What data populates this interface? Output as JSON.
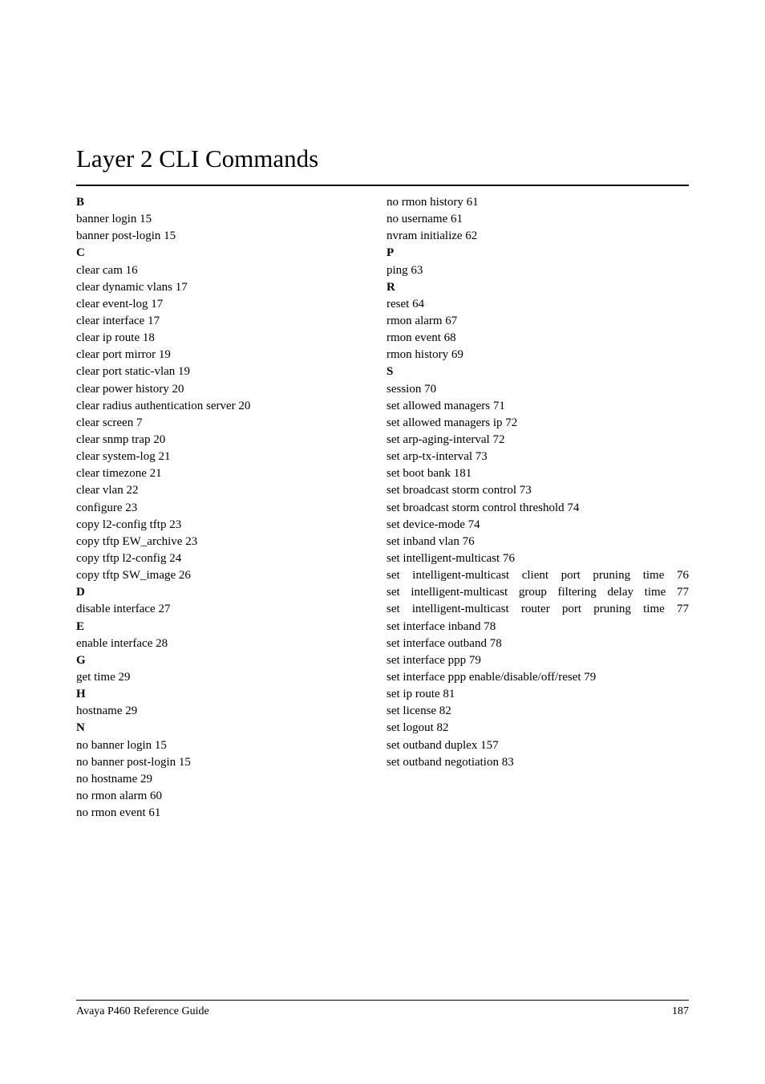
{
  "title": "Layer 2 CLI Commands",
  "left": [
    {
      "t": "letter",
      "v": "B"
    },
    {
      "t": "entry",
      "v": "banner login 15"
    },
    {
      "t": "entry",
      "v": "banner post-login 15"
    },
    {
      "t": "letter",
      "v": "C"
    },
    {
      "t": "entry",
      "v": "clear cam 16"
    },
    {
      "t": "entry",
      "v": "clear dynamic vlans 17"
    },
    {
      "t": "entry",
      "v": "clear event-log 17"
    },
    {
      "t": "entry",
      "v": "clear interface 17"
    },
    {
      "t": "entry",
      "v": "clear ip route 18"
    },
    {
      "t": "entry",
      "v": "clear port mirror 19"
    },
    {
      "t": "entry",
      "v": "clear port static-vlan 19"
    },
    {
      "t": "entry",
      "v": "clear power history 20"
    },
    {
      "t": "entry",
      "v": "clear radius authentication server 20"
    },
    {
      "t": "entry",
      "v": "clear screen 7"
    },
    {
      "t": "entry",
      "v": "clear snmp trap 20"
    },
    {
      "t": "entry",
      "v": "clear system-log 21"
    },
    {
      "t": "entry",
      "v": "clear timezone 21"
    },
    {
      "t": "entry",
      "v": "clear vlan 22"
    },
    {
      "t": "entry",
      "v": "configure 23"
    },
    {
      "t": "entry",
      "v": "copy l2-config tftp 23"
    },
    {
      "t": "entry",
      "v": "copy tftp EW_archive 23"
    },
    {
      "t": "entry",
      "v": "copy tftp l2-config 24"
    },
    {
      "t": "entry",
      "v": "copy tftp SW_image 26"
    },
    {
      "t": "letter",
      "v": "D"
    },
    {
      "t": "entry",
      "v": "disable interface 27"
    },
    {
      "t": "letter",
      "v": "E"
    },
    {
      "t": "entry",
      "v": "enable interface 28"
    },
    {
      "t": "letter",
      "v": "G"
    },
    {
      "t": "entry",
      "v": "get time 29"
    },
    {
      "t": "letter",
      "v": "H"
    },
    {
      "t": "entry",
      "v": "hostname 29"
    },
    {
      "t": "letter",
      "v": "N"
    },
    {
      "t": "entry",
      "v": "no banner login 15"
    },
    {
      "t": "entry",
      "v": "no banner post-login 15"
    },
    {
      "t": "entry",
      "v": "no hostname 29"
    },
    {
      "t": "entry",
      "v": "no rmon alarm 60"
    },
    {
      "t": "entry",
      "v": "no rmon event 61"
    }
  ],
  "right": [
    {
      "t": "entry",
      "v": "no rmon history 61"
    },
    {
      "t": "entry",
      "v": "no username 61"
    },
    {
      "t": "entry",
      "v": "nvram initialize 62"
    },
    {
      "t": "letter",
      "v": "P"
    },
    {
      "t": "entry",
      "v": "ping 63"
    },
    {
      "t": "letter",
      "v": "R"
    },
    {
      "t": "entry",
      "v": "reset 64"
    },
    {
      "t": "entry",
      "v": "rmon alarm 67"
    },
    {
      "t": "entry",
      "v": "rmon event 68"
    },
    {
      "t": "entry",
      "v": "rmon history 69"
    },
    {
      "t": "letter",
      "v": "S"
    },
    {
      "t": "entry",
      "v": "session 70"
    },
    {
      "t": "entry",
      "v": "set allowed managers 71"
    },
    {
      "t": "entry",
      "v": "set allowed managers ip 72"
    },
    {
      "t": "entry",
      "v": "set arp-aging-interval 72"
    },
    {
      "t": "entry",
      "v": "set arp-tx-interval 73"
    },
    {
      "t": "entry",
      "v": "set boot bank 181"
    },
    {
      "t": "entry",
      "v": "set broadcast storm control 73"
    },
    {
      "t": "entry",
      "v": "set broadcast storm control threshold 74"
    },
    {
      "t": "entry",
      "v": "set device-mode 74"
    },
    {
      "t": "entry",
      "v": "set inband vlan 76"
    },
    {
      "t": "entry",
      "v": "set intelligent-multicast 76"
    },
    {
      "t": "entry",
      "j": true,
      "v": "set intelligent-multicast client port pruning time 76"
    },
    {
      "t": "entry",
      "j": true,
      "v": "set intelligent-multicast group filtering delay time 77"
    },
    {
      "t": "entry",
      "j": true,
      "v": "set intelligent-multicast router port pruning time 77"
    },
    {
      "t": "entry",
      "v": "set interface inband 78"
    },
    {
      "t": "entry",
      "v": "set interface outband 78"
    },
    {
      "t": "entry",
      "v": "set interface ppp 79"
    },
    {
      "t": "entry",
      "v": "set interface ppp enable/disable/off/reset 79"
    },
    {
      "t": "entry",
      "v": "set ip route 81"
    },
    {
      "t": "entry",
      "v": "set license 82"
    },
    {
      "t": "entry",
      "v": "set logout 82"
    },
    {
      "t": "entry",
      "v": "set outband duplex 157"
    },
    {
      "t": "entry",
      "v": "set outband negotiation 83"
    }
  ],
  "footer_left": "Avaya P460 Reference Guide",
  "footer_right": "187"
}
